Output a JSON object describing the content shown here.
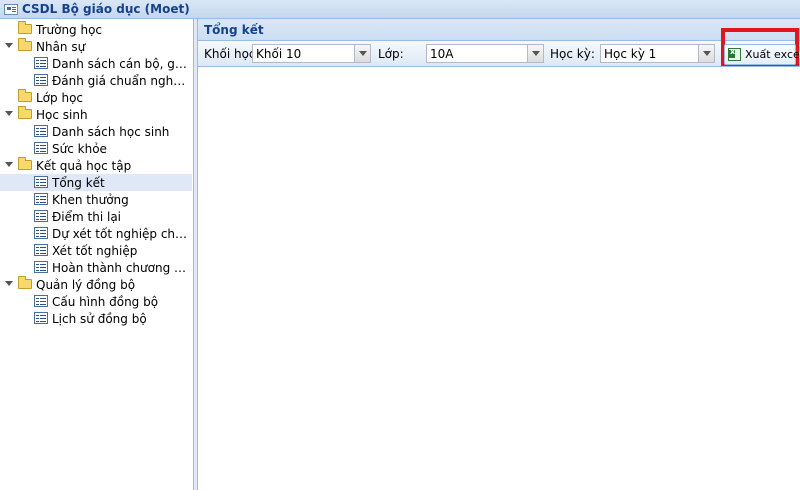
{
  "app": {
    "title": "CSDL Bộ giáo dục (Moet)"
  },
  "tree": [
    {
      "type": "folder",
      "label": "Trường học",
      "expanded": false,
      "level": 0
    },
    {
      "type": "folder",
      "label": "Nhân sự",
      "expanded": true,
      "level": 0
    },
    {
      "type": "item",
      "label": "Danh sách cán bộ, giáo viên",
      "level": 1
    },
    {
      "type": "item",
      "label": "Đánh giá chuẩn nghề nghiệp",
      "level": 1
    },
    {
      "type": "folder",
      "label": "Lớp học",
      "expanded": false,
      "level": 0
    },
    {
      "type": "folder",
      "label": "Học sinh",
      "expanded": true,
      "level": 0
    },
    {
      "type": "item",
      "label": "Danh sách học sinh",
      "level": 1
    },
    {
      "type": "item",
      "label": "Sức khỏe",
      "level": 1
    },
    {
      "type": "folder",
      "label": "Kết quả học tập",
      "expanded": true,
      "level": 0
    },
    {
      "type": "item",
      "label": "Tổng kết",
      "level": 1,
      "selected": true
    },
    {
      "type": "item",
      "label": "Khen thưởng",
      "level": 1
    },
    {
      "type": "item",
      "label": "Điểm thi lại",
      "level": 1
    },
    {
      "type": "item",
      "label": "Dự xét tốt nghiệp cho thí sinh tự do",
      "level": 1
    },
    {
      "type": "item",
      "label": "Xét tốt nghiệp",
      "level": 1
    },
    {
      "type": "item",
      "label": "Hoàn thành chương trình",
      "level": 1
    },
    {
      "type": "folder",
      "label": "Quản lý đồng bộ",
      "expanded": true,
      "level": 0
    },
    {
      "type": "item",
      "label": "Cấu hình đồng bộ",
      "level": 1
    },
    {
      "type": "item",
      "label": "Lịch sử đồng bộ",
      "level": 1
    }
  ],
  "panel": {
    "title": "Tổng kết",
    "toolbar": {
      "grade_label": "Khối học:",
      "grade_value": "Khối 10",
      "class_label": "Lớp:",
      "class_value": "10A",
      "term_label": "Học kỳ:",
      "term_value": "Học kỳ 1",
      "export_label": "Xuất excel"
    }
  },
  "colors": {
    "accent_title": "#15428b",
    "border": "#99bbe8",
    "highlight": "#e3141e"
  }
}
